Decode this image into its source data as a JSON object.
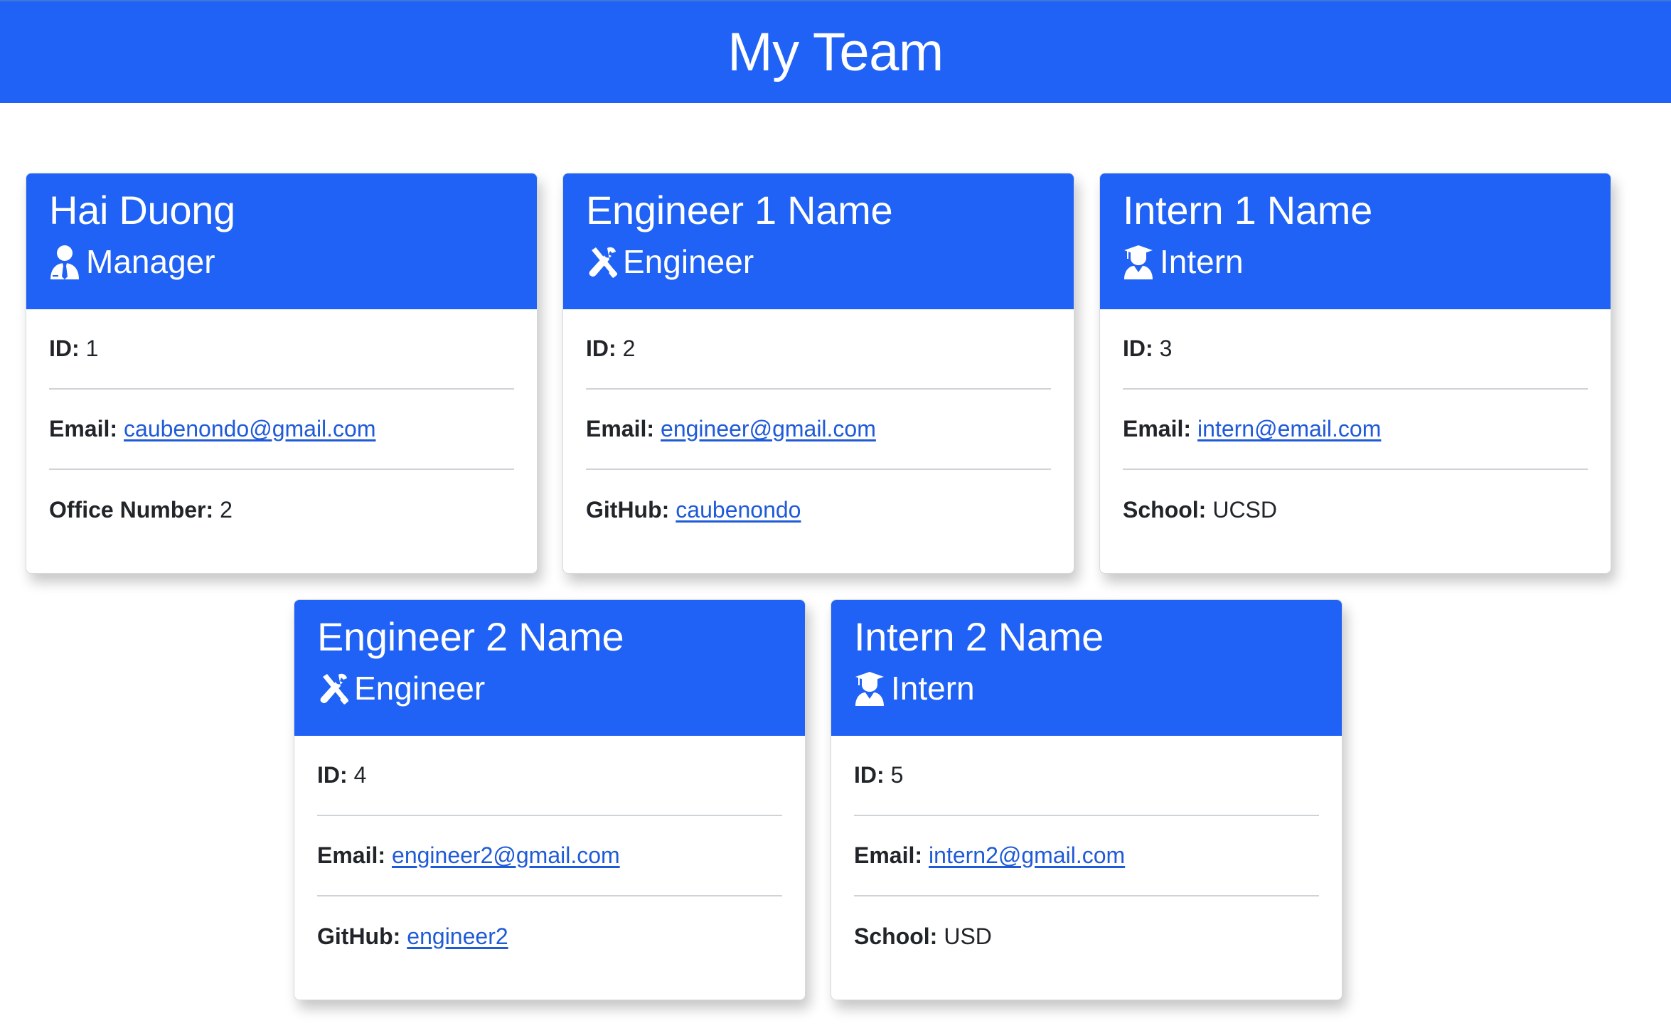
{
  "page": {
    "title": "My Team"
  },
  "labels": {
    "id": "ID:",
    "email": "Email:",
    "office": "Office Number:",
    "github": "GitHub:",
    "school": "School:"
  },
  "colors": {
    "header_bg": "#1f62f5",
    "link": "#1f5ad8"
  },
  "cards": [
    {
      "name": "Hai Duong",
      "role": "Manager",
      "icon": "user-tie-icon",
      "id": "1",
      "email": "caubenondo@gmail.com",
      "extra_value": "2"
    },
    {
      "name": "Engineer 1 Name",
      "role": "Engineer",
      "icon": "tools-icon",
      "id": "2",
      "email": "engineer@gmail.com",
      "extra_value": "caubenondo"
    },
    {
      "name": "Intern 1 Name",
      "role": "Intern",
      "icon": "graduate-icon",
      "id": "3",
      "email": "intern@email.com",
      "extra_value": "UCSD"
    },
    {
      "name": "Engineer 2 Name",
      "role": "Engineer",
      "icon": "tools-icon",
      "id": "4",
      "email": "engineer2@gmail.com",
      "extra_value": "engineer2"
    },
    {
      "name": "Intern 2 Name",
      "role": "Intern",
      "icon": "graduate-icon",
      "id": "5",
      "email": "intern2@gmail.com",
      "extra_value": "USD"
    }
  ]
}
